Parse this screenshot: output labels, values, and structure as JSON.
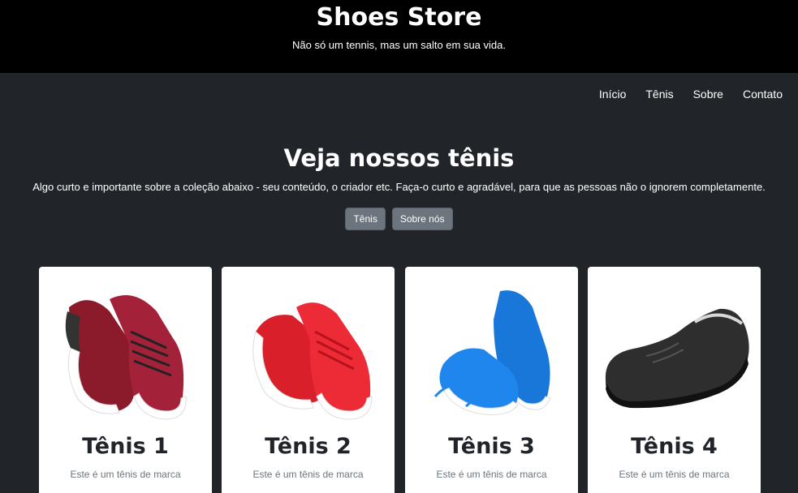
{
  "header": {
    "title": "Shoes Store",
    "tagline": "Não só um tennis, mas um salto em sua vida."
  },
  "nav": {
    "items": [
      {
        "label": "Início"
      },
      {
        "label": "Tênis"
      },
      {
        "label": "Sobre"
      },
      {
        "label": "Contato"
      }
    ]
  },
  "hero": {
    "title": "Veja nossos tênis",
    "text": "Algo curto e importante sobre a coleção abaixo - seu conteúdo, o criador etc. Faça-o curto e agradável, para que as pessoas não o ignorem completamente.",
    "buttons": [
      {
        "label": "Tênis"
      },
      {
        "label": "Sobre nós"
      }
    ]
  },
  "cards": [
    {
      "title": "Tênis 1",
      "text": "Este é um tênis de marca",
      "color": "#8b1a2b",
      "icon": "red-black-sneakers-image"
    },
    {
      "title": "Tênis 2",
      "text": "Este é um tênis de marca",
      "color": "#e0242e",
      "icon": "red-sneakers-image"
    },
    {
      "title": "Tênis 3",
      "text": "Este é um tênis de marca",
      "color": "#1877d8",
      "icon": "blue-sneakers-image"
    },
    {
      "title": "Tênis 4",
      "text": "Este é um tênis de marca",
      "color": "#2e2e2e",
      "icon": "black-slip-on-shoe-image"
    }
  ]
}
